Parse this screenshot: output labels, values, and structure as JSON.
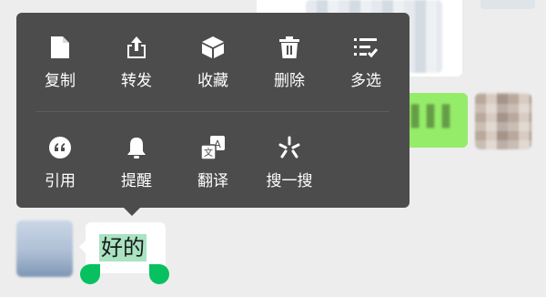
{
  "chat": {
    "message_text": "好的"
  },
  "context_menu": {
    "row1": [
      {
        "label": "复制",
        "icon": "copy-icon"
      },
      {
        "label": "转发",
        "icon": "forward-icon"
      },
      {
        "label": "收藏",
        "icon": "favorite-icon"
      },
      {
        "label": "删除",
        "icon": "delete-icon"
      },
      {
        "label": "多选",
        "icon": "multi-select-icon"
      }
    ],
    "row2": [
      {
        "label": "引用",
        "icon": "quote-icon"
      },
      {
        "label": "提醒",
        "icon": "remind-icon"
      },
      {
        "label": "翻译",
        "icon": "translate-icon"
      },
      {
        "label": "搜一搜",
        "icon": "search-icon"
      }
    ]
  },
  "colors": {
    "menu_bg": "#4c4c4c",
    "selection_handle": "#07c160",
    "selection_highlight": "#a9e3c2",
    "sent_bubble": "#95ec69",
    "chat_bg": "#ededed"
  }
}
